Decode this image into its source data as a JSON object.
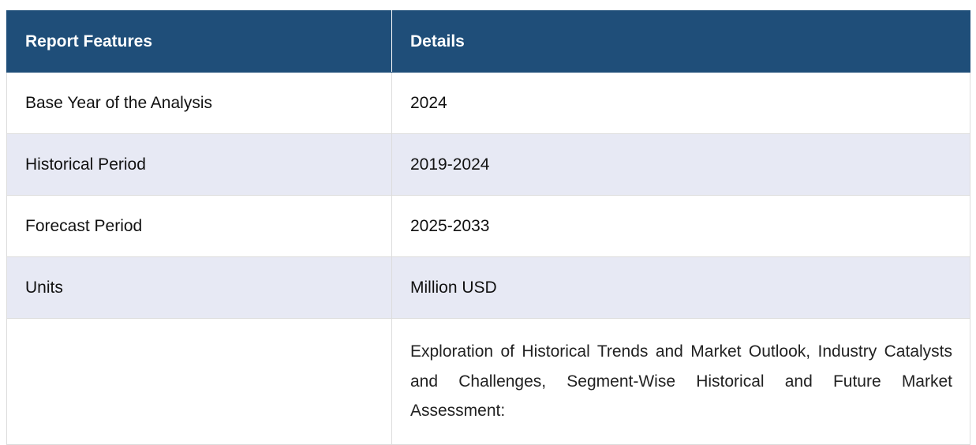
{
  "header": {
    "col1": "Report Features",
    "col2": "Details"
  },
  "rows": [
    {
      "feature": "Base Year of the Analysis",
      "detail": "2024"
    },
    {
      "feature": "Historical Period",
      "detail": "2019-2024"
    },
    {
      "feature": "Forecast Period",
      "detail": "2025-2033"
    },
    {
      "feature": "Units",
      "detail": "Million USD"
    }
  ],
  "scope": {
    "feature": "",
    "description": "Exploration of Historical Trends and Market Outlook, Industry Catalysts and Challenges, Segment-Wise Historical and Future Market Assessment:"
  },
  "colors": {
    "header_bg": "#1f4e79",
    "alt_row_bg": "#e7e9f4",
    "border": "#dcdcdc"
  }
}
